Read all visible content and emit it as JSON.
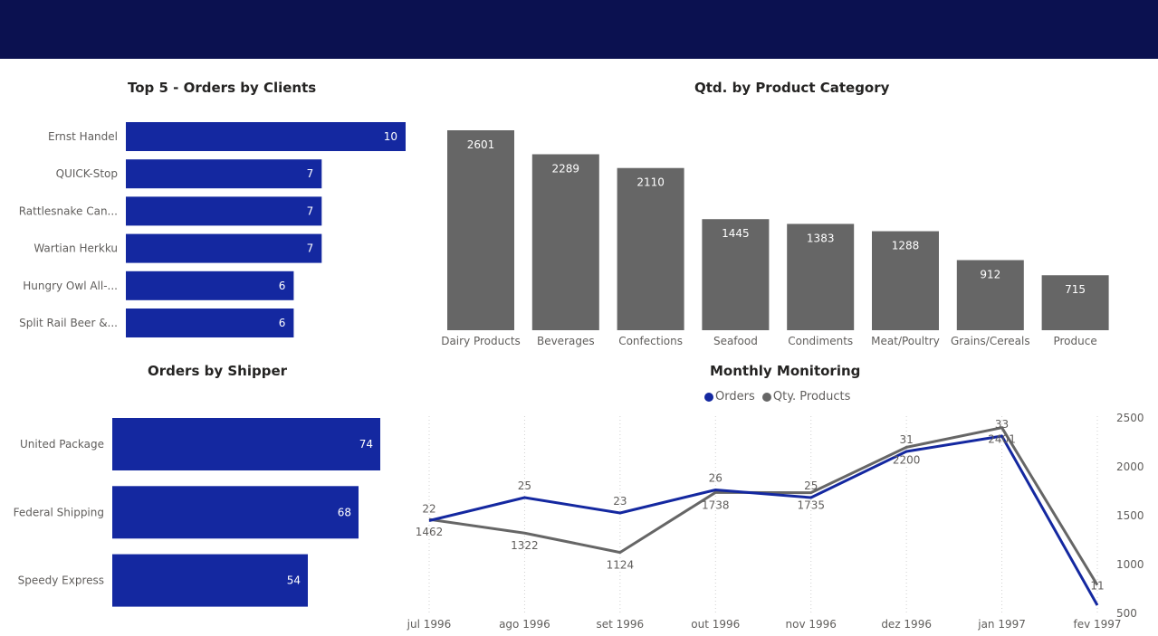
{
  "colors": {
    "header": "#0b1150",
    "navy": "#1428a0",
    "gray": "#666666"
  },
  "clients": {
    "title": "Top 5 - Orders by Clients",
    "chart_data": {
      "type": "bar",
      "orientation": "horizontal",
      "categories": [
        "Ernst Handel",
        "QUICK-Stop",
        "Rattlesnake Can...",
        "Wartian Herkku",
        "Hungry Owl All-...",
        "Split Rail Beer &..."
      ],
      "values": [
        10,
        7,
        7,
        7,
        6,
        6
      ]
    }
  },
  "category": {
    "title": "Qtd. by Product Category",
    "chart_data": {
      "type": "bar",
      "categories": [
        "Dairy Products",
        "Beverages",
        "Confections",
        "Seafood",
        "Condiments",
        "Meat/Poultry",
        "Grains/Cereals",
        "Produce"
      ],
      "values": [
        2601,
        2289,
        2110,
        1445,
        1383,
        1288,
        912,
        715
      ]
    }
  },
  "shipper": {
    "title": "Orders by Shipper",
    "chart_data": {
      "type": "bar",
      "orientation": "horizontal",
      "categories": [
        "United Package",
        "Federal Shipping",
        "Speedy Express"
      ],
      "values": [
        74,
        68,
        54
      ]
    }
  },
  "monthly": {
    "title": "Monthly Monitoring",
    "legend": {
      "orders": "Orders",
      "qty": "Qty. Products"
    },
    "chart_data": {
      "type": "line",
      "x": [
        "jul 1996",
        "ago 1996",
        "set 1996",
        "out 1996",
        "nov 1996",
        "dez 1996",
        "jan 1997",
        "fev 1997"
      ],
      "series": [
        {
          "name": "Orders",
          "values": [
            22,
            25,
            23,
            26,
            25,
            31,
            33,
            11
          ]
        },
        {
          "name": "Qty. Products",
          "values": [
            1462,
            1322,
            1124,
            1738,
            1735,
            2200,
            2401,
            790
          ]
        }
      ],
      "y_right_ticks": [
        "2500",
        "2000",
        "1500",
        "1000",
        "500"
      ],
      "y_right_range": [
        500,
        2500
      ],
      "grid": "vertical dotted",
      "legend_position": "top-center"
    }
  }
}
